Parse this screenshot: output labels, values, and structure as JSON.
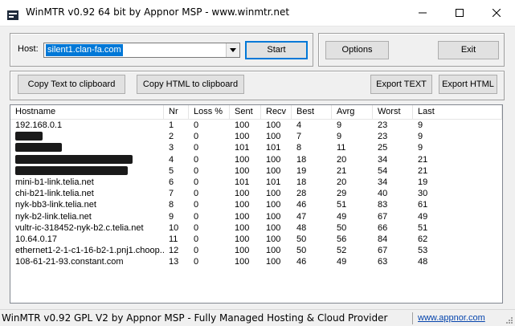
{
  "window": {
    "title": "WinMTR v0.92 64 bit by Appnor MSP - www.winmtr.net"
  },
  "host": {
    "label": "Host:",
    "value": "silent1.clan-fa.com"
  },
  "buttons": {
    "start": "Start",
    "options": "Options",
    "exit": "Exit",
    "copy_text": "Copy Text to clipboard",
    "copy_html": "Copy HTML to clipboard",
    "export_text": "Export TEXT",
    "export_html": "Export HTML"
  },
  "table": {
    "columns": [
      "Hostname",
      "Nr",
      "Loss %",
      "Sent",
      "Recv",
      "Best",
      "Avrg",
      "Worst",
      "Last"
    ],
    "rows": [
      {
        "hostname": "192.168.0.1",
        "nr": "1",
        "loss": "0",
        "sent": "100",
        "recv": "100",
        "best": "4",
        "avrg": "9",
        "worst": "23",
        "last": "9"
      },
      {
        "hostname": "",
        "redacted": true,
        "nr": "2",
        "loss": "0",
        "sent": "100",
        "recv": "100",
        "best": "7",
        "avrg": "9",
        "worst": "23",
        "last": "9"
      },
      {
        "hostname": "",
        "redacted": true,
        "nr": "3",
        "loss": "0",
        "sent": "101",
        "recv": "101",
        "best": "8",
        "avrg": "11",
        "worst": "25",
        "last": "9"
      },
      {
        "hostname": "",
        "redacted": true,
        "nr": "4",
        "loss": "0",
        "sent": "100",
        "recv": "100",
        "best": "18",
        "avrg": "20",
        "worst": "34",
        "last": "21"
      },
      {
        "hostname": "",
        "redacted": true,
        "nr": "5",
        "loss": "0",
        "sent": "100",
        "recv": "100",
        "best": "19",
        "avrg": "21",
        "worst": "54",
        "last": "21"
      },
      {
        "hostname": "mini-b1-link.telia.net",
        "nr": "6",
        "loss": "0",
        "sent": "101",
        "recv": "101",
        "best": "18",
        "avrg": "20",
        "worst": "34",
        "last": "19"
      },
      {
        "hostname": "chi-b21-link.telia.net",
        "nr": "7",
        "loss": "0",
        "sent": "100",
        "recv": "100",
        "best": "28",
        "avrg": "29",
        "worst": "40",
        "last": "30"
      },
      {
        "hostname": "nyk-bb3-link.telia.net",
        "nr": "8",
        "loss": "0",
        "sent": "100",
        "recv": "100",
        "best": "46",
        "avrg": "51",
        "worst": "83",
        "last": "61"
      },
      {
        "hostname": "nyk-b2-link.telia.net",
        "nr": "9",
        "loss": "0",
        "sent": "100",
        "recv": "100",
        "best": "47",
        "avrg": "49",
        "worst": "67",
        "last": "49"
      },
      {
        "hostname": "vultr-ic-318452-nyk-b2.c.telia.net",
        "nr": "10",
        "loss": "0",
        "sent": "100",
        "recv": "100",
        "best": "48",
        "avrg": "50",
        "worst": "66",
        "last": "51"
      },
      {
        "hostname": "10.64.0.17",
        "nr": "11",
        "loss": "0",
        "sent": "100",
        "recv": "100",
        "best": "50",
        "avrg": "56",
        "worst": "84",
        "last": "62"
      },
      {
        "hostname": "ethernet1-2-1-c1-16-b2-1.pnj1.choop...",
        "nr": "12",
        "loss": "0",
        "sent": "100",
        "recv": "100",
        "best": "50",
        "avrg": "52",
        "worst": "67",
        "last": "53"
      },
      {
        "hostname": "108-61-21-93.constant.com",
        "nr": "13",
        "loss": "0",
        "sent": "100",
        "recv": "100",
        "best": "46",
        "avrg": "49",
        "worst": "63",
        "last": "48"
      }
    ]
  },
  "statusbar": {
    "text": "WinMTR v0.92 GPL V2 by Appnor MSP - Fully Managed Hosting & Cloud Provider",
    "link": "www.appnor.com"
  },
  "colors": {
    "selection": "#0078d7",
    "link": "#0645ad",
    "redaction": "#1a1a1a"
  },
  "icons": [
    "app-icon",
    "minimize-icon",
    "maximize-icon",
    "close-icon",
    "dropdown-arrow-icon",
    "size-grip-icon"
  ]
}
